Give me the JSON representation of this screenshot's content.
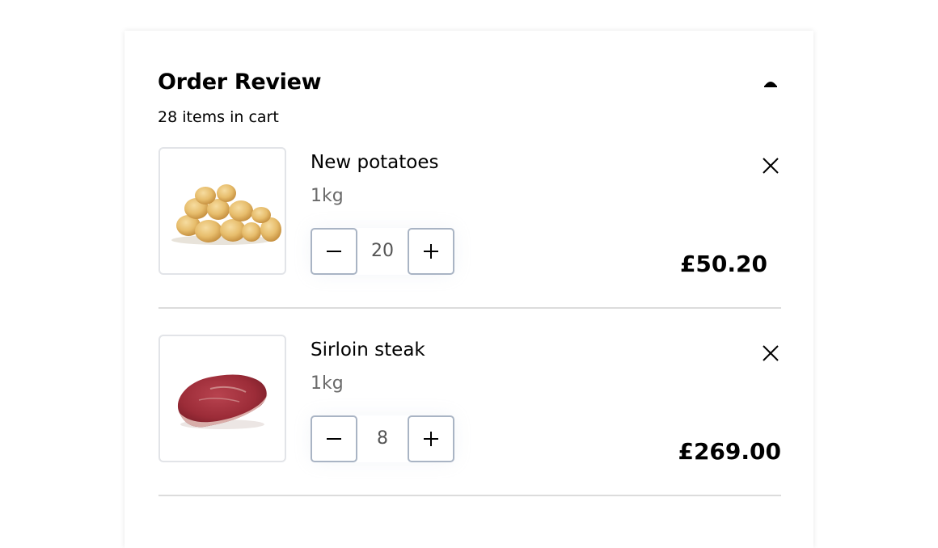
{
  "order_review": {
    "title": "Order Review",
    "item_count_text": "28 items in cart",
    "collapse_icon": "caret-up-icon"
  },
  "items": [
    {
      "name": "New potatoes",
      "size": "1kg",
      "quantity": "20",
      "price": "£50.20",
      "image": "potatoes-image",
      "minus_icon": "minus-icon",
      "plus_icon": "plus-icon",
      "remove_icon": "close-icon"
    },
    {
      "name": "Sirloin steak",
      "size": "1kg",
      "quantity": "8",
      "price": "£269.00",
      "image": "steak-image",
      "minus_icon": "minus-icon",
      "plus_icon": "plus-icon",
      "remove_icon": "close-icon"
    }
  ],
  "colors": {
    "stepper_border": "#a9b4c4",
    "thumb_border": "#e2e4e8",
    "divider": "#dcdcdc",
    "muted_text": "#6a6a6a"
  }
}
